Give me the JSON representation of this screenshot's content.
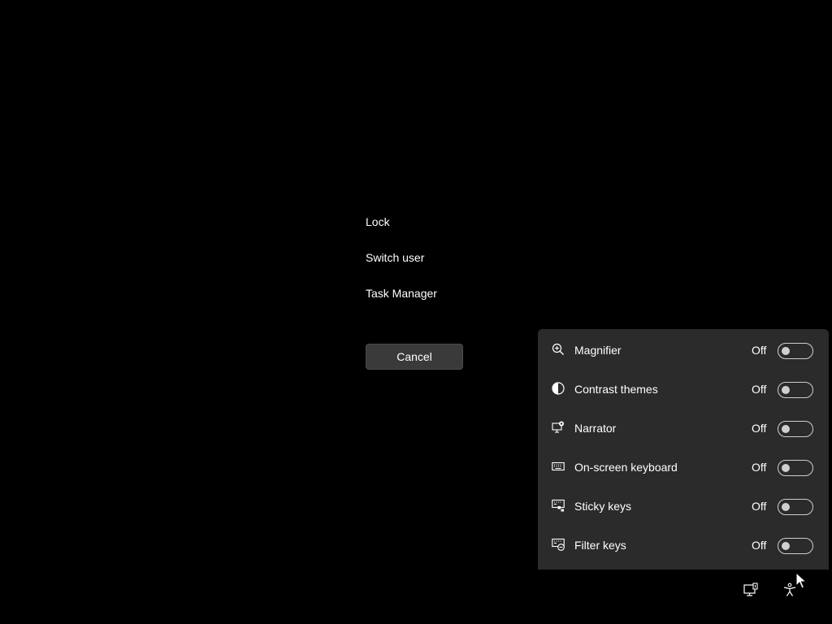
{
  "options": {
    "lock": "Lock",
    "switch_user": "Switch user",
    "task_manager": "Task Manager"
  },
  "cancel_label": "Cancel",
  "accessibility_flyout": {
    "items": [
      {
        "label": "Magnifier",
        "state": "Off",
        "icon": "magnifier-icon",
        "on": false
      },
      {
        "label": "Contrast themes",
        "state": "Off",
        "icon": "contrast-icon",
        "on": false
      },
      {
        "label": "Narrator",
        "state": "Off",
        "icon": "narrator-icon",
        "on": false
      },
      {
        "label": "On-screen keyboard",
        "state": "Off",
        "icon": "keyboard-icon",
        "on": false
      },
      {
        "label": "Sticky keys",
        "state": "Off",
        "icon": "sticky-keys-icon",
        "on": false
      },
      {
        "label": "Filter keys",
        "state": "Off",
        "icon": "filter-keys-icon",
        "on": false
      }
    ]
  },
  "tray": {
    "network_icon": "network-icon",
    "accessibility_icon": "accessibility-icon"
  },
  "colors": {
    "background": "#000000",
    "flyout_bg": "#2b2b2b",
    "button_bg": "#3a3a3a",
    "toggle_off": "#cfcfcf"
  }
}
